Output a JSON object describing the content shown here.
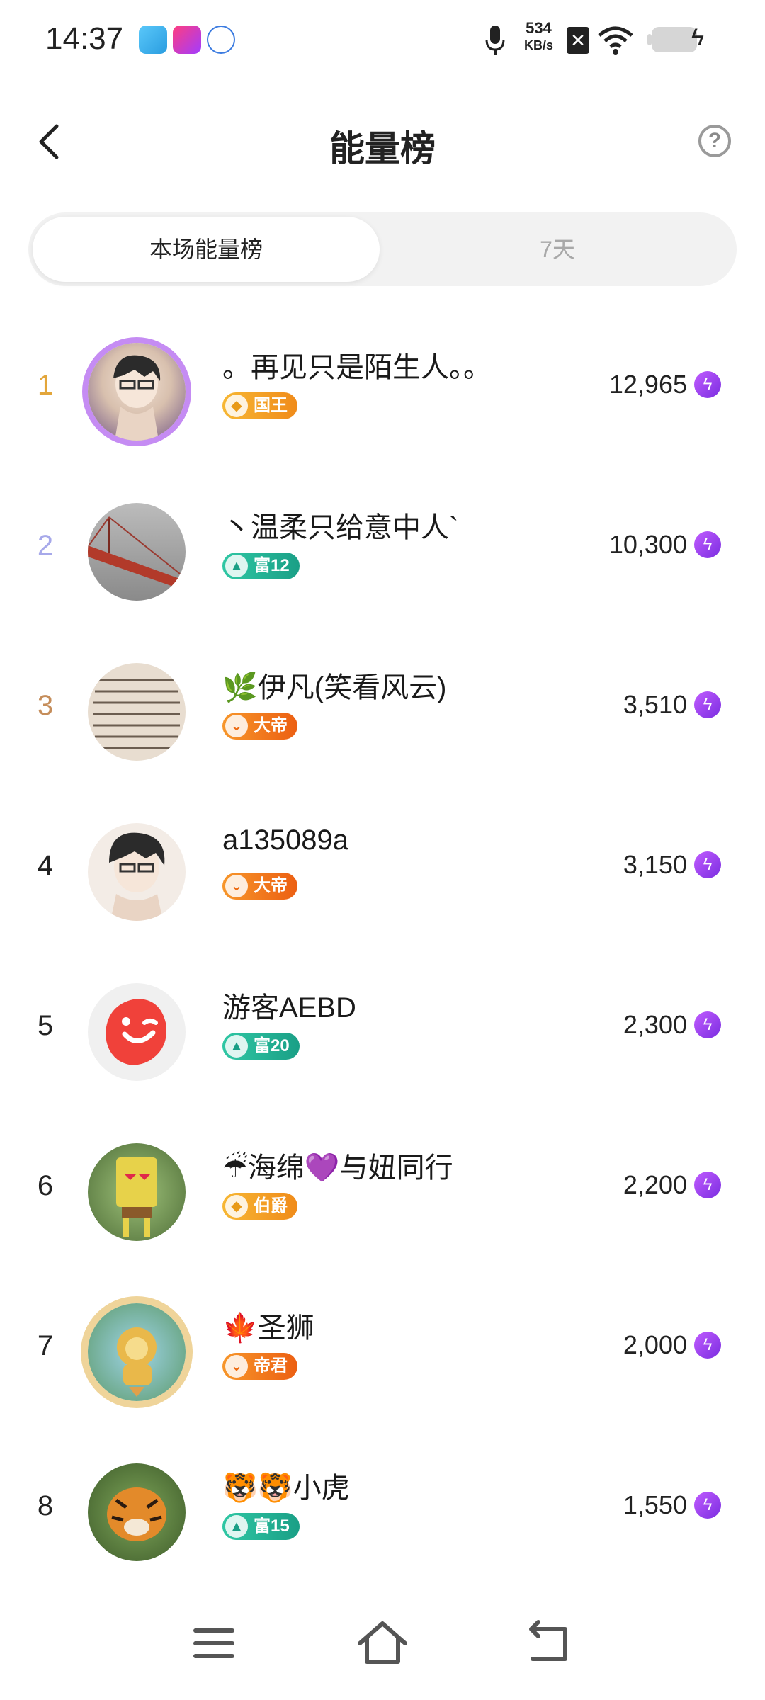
{
  "status_bar": {
    "time": "14:37",
    "net_speed_value": "534",
    "net_speed_unit": "KB/s",
    "icons": [
      "telegram-icon",
      "app-icon",
      "iflt-icon",
      "mic-icon",
      "sim-off-icon",
      "wifi-icon",
      "battery-icon",
      "charging-icon"
    ]
  },
  "header": {
    "title": "能量榜",
    "help_symbol": "?"
  },
  "tabs": [
    {
      "label": "本场能量榜",
      "active": true
    },
    {
      "label": "7天",
      "active": false
    }
  ],
  "ranking": [
    {
      "rank": "1",
      "name": "。再见只是陌生人。。",
      "badge": "国王",
      "badge_color": "#f4a825",
      "score": "12,965",
      "rank_color": "#e3a63b"
    },
    {
      "rank": "2",
      "name": "丶温柔只给意中人`",
      "badge": "富12",
      "badge_color": "#28b79b",
      "score": "10,300",
      "rank_color": "#a7a9ea"
    },
    {
      "rank": "3",
      "name": "🌿伊凡(笑看风云)",
      "badge": "大帝",
      "badge_color": "#f27a1a",
      "score": "3,510",
      "rank_color": "#c58d5a"
    },
    {
      "rank": "4",
      "name": "a135089a",
      "badge": "大帝",
      "badge_color": "#f27a1a",
      "score": "3,150",
      "rank_color": "#222222"
    },
    {
      "rank": "5",
      "name": "游客AEBD",
      "badge": "富20",
      "badge_color": "#28b79b",
      "score": "2,300",
      "rank_color": "#222222"
    },
    {
      "rank": "6",
      "name": "☔海绵💜与妞同行",
      "badge": "伯爵",
      "badge_color": "#f4a825",
      "score": "2,200",
      "rank_color": "#222222"
    },
    {
      "rank": "7",
      "name": "🍁圣狮",
      "badge": "帝君",
      "badge_color": "#f27a1a",
      "score": "2,000",
      "rank_color": "#222222"
    },
    {
      "rank": "8",
      "name": "🐯🐯小虎",
      "badge": "富15",
      "badge_color": "#28b79b",
      "score": "1,550",
      "rank_color": "#222222"
    }
  ],
  "nav_bar": {
    "buttons": [
      "menu-icon",
      "home-icon",
      "back-nav-icon"
    ]
  }
}
